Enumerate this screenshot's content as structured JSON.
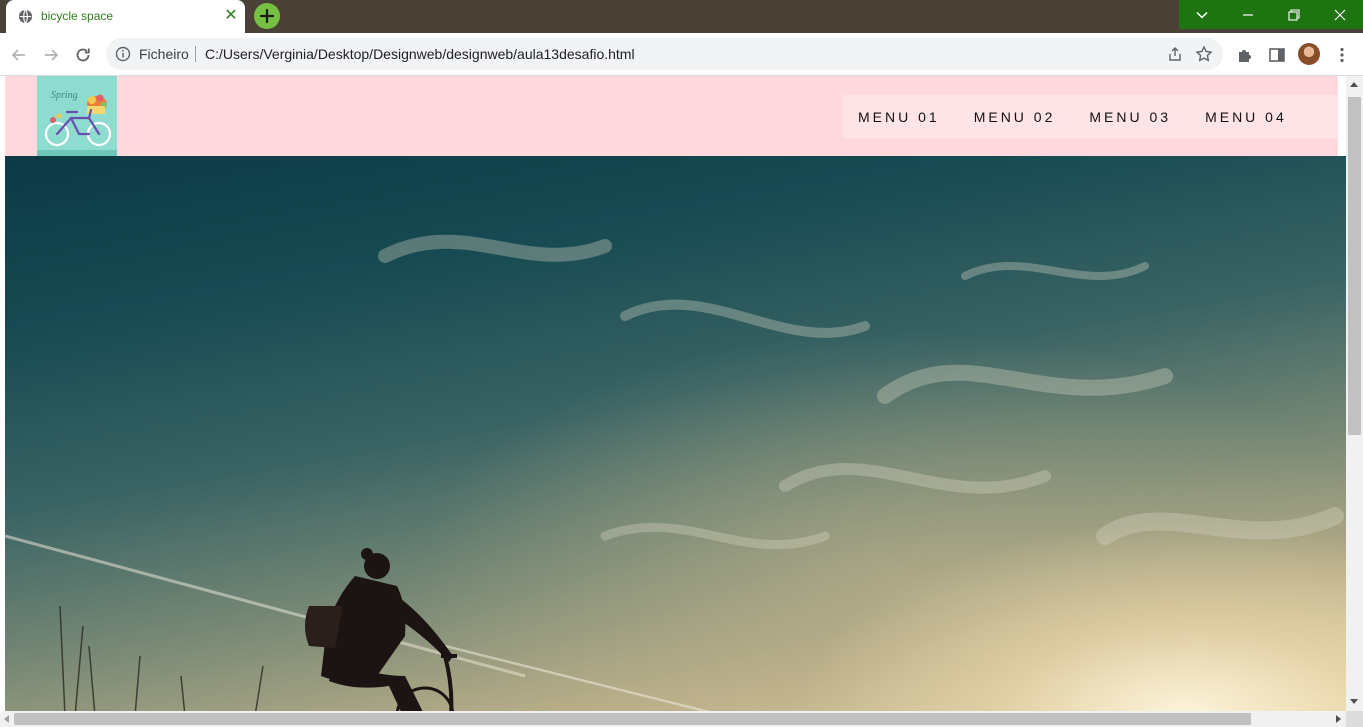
{
  "browser": {
    "tab": {
      "title": "bicycle space",
      "favicon": "globe-icon"
    },
    "new_tab_icon": "plus-icon",
    "window_controls": [
      "chevron-down-icon",
      "minimize-icon",
      "restore-icon",
      "close-icon"
    ],
    "toolbar": {
      "back_icon": "arrow-left-icon",
      "forward_icon": "arrow-right-icon",
      "reload_icon": "reload-icon",
      "site_info_icon": "info-icon",
      "scheme_label": "Ficheiro",
      "url": "C:/Users/Verginia/Desktop/Designweb/designweb/aula13desafio.html",
      "share_icon": "share-icon",
      "bookmark_icon": "star-icon",
      "extensions_icon": "puzzle-icon",
      "side_panel_icon": "side-panel-icon",
      "menu_icon": "kebab-menu-icon"
    },
    "colors": {
      "tabstrip": "#4a4236",
      "tab_text": "#2f7d1e",
      "new_tab": "#77c043",
      "window_controls": "#1d7410"
    }
  },
  "page": {
    "header_bg": "#ffd9de",
    "menu_bg": "#ffe4e7",
    "logo": {
      "text": "Spring",
      "bg": "#8edcd0"
    },
    "menu": [
      {
        "label": "MENU 01"
      },
      {
        "label": "MENU 02"
      },
      {
        "label": "MENU 03"
      },
      {
        "label": "MENU 04"
      }
    ],
    "hero": {
      "subject": "cyclist silhouette at sunset"
    }
  }
}
